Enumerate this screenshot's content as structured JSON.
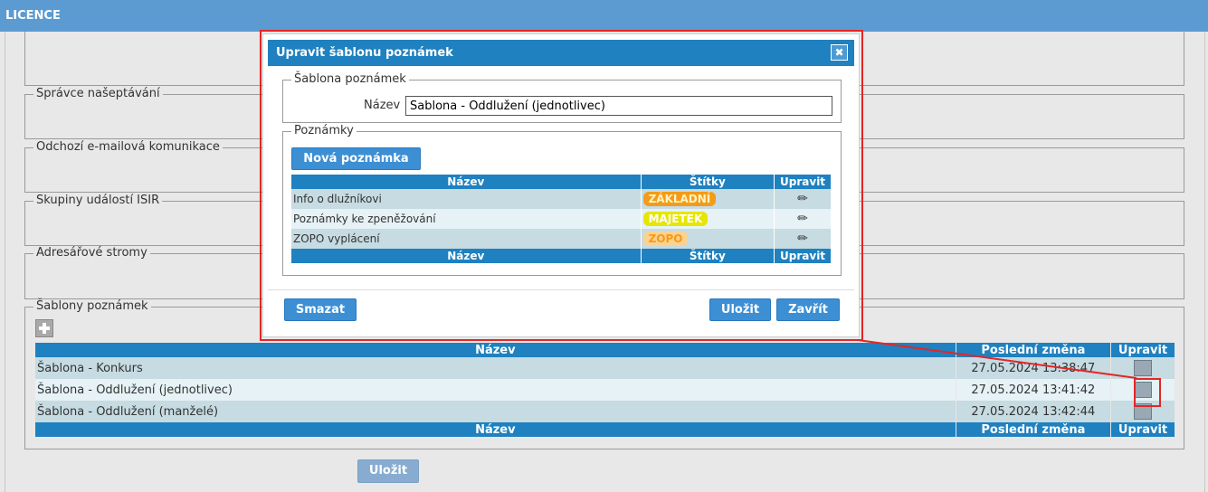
{
  "topbar": {
    "title": "LICENCE"
  },
  "sections": {
    "suggest_admin": "Správce našeptávání",
    "email": "Odchozí e-mailová komunikace",
    "isir_groups": "Skupiny událostí ISIR",
    "address_trees": "Adresářové stromy",
    "note_templates": "Šablony poznámek"
  },
  "templates_table": {
    "headers": {
      "name": "Název",
      "last_change": "Poslední změna",
      "edit": "Upravit"
    },
    "rows": [
      {
        "name": "Šablona - Konkurs",
        "last_change": "27.05.2024 13:38:47"
      },
      {
        "name": "Šablona - Oddlužení (jednotlivec)",
        "last_change": "27.05.2024 13:41:42"
      },
      {
        "name": "Šablona - Oddlužení (manželé)",
        "last_change": "27.05.2024 13:42:44"
      }
    ]
  },
  "save_label": "Uložit",
  "dialog": {
    "title": "Upravit šablonu poznámek",
    "close_glyph": "✖",
    "template_legend": "Šablona poznámek",
    "name_label": "Název",
    "name_value": "Šablona - Oddlužení (jednotlivec)",
    "notes_legend": "Poznámky",
    "new_note_label": "Nová poznámka",
    "notes_headers": {
      "name": "Název",
      "tags": "Štítky",
      "edit": "Upravit"
    },
    "notes": [
      {
        "name": "Info o dlužníkovi",
        "tag": "ZÁKLADNÍ",
        "tag_bg": "#f39c1a",
        "tag_fg": "#fff3c0"
      },
      {
        "name": "Poznámky ke zpeněžování",
        "tag": "MAJETEK",
        "tag_bg": "#e6e600",
        "tag_fg": "#ffffff"
      },
      {
        "name": "ZOPO vyplácení",
        "tag": "ZOPO",
        "tag_bg": "#fcd28f",
        "tag_fg": "#f59a1a"
      }
    ],
    "delete_label": "Smazat",
    "save_label": "Uložit",
    "close_label": "Zavřít"
  },
  "colors": {
    "header_blue": "#1f81c0",
    "topbar_blue": "#5b9bd1",
    "highlight_red": "#e32626"
  }
}
